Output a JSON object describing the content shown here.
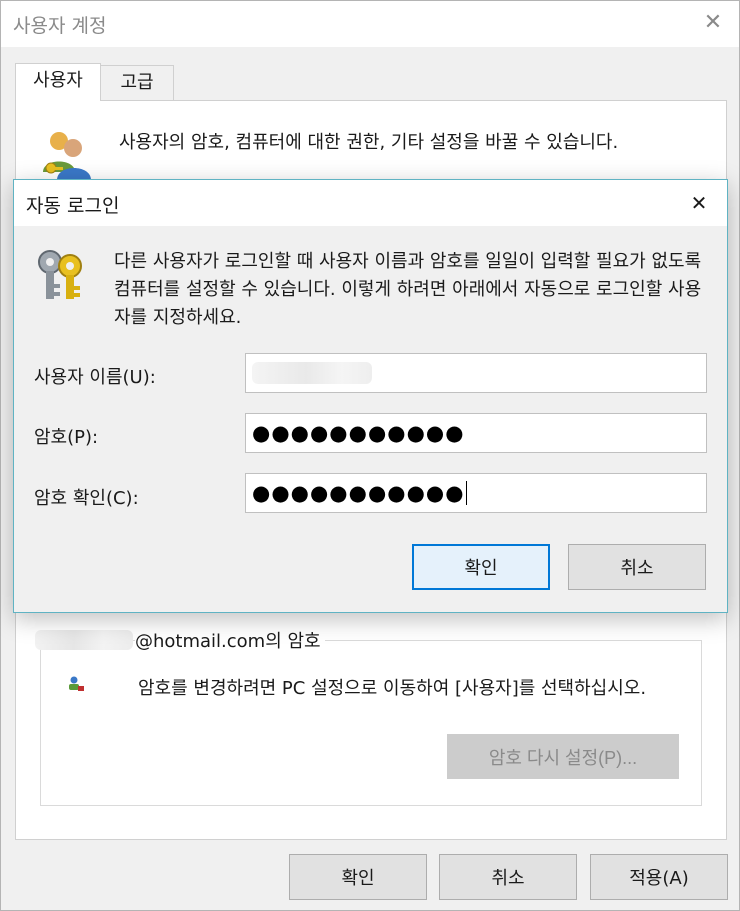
{
  "window": {
    "title": "사용자 계정",
    "close_glyph": "✕",
    "tabs": [
      {
        "label": "사용자",
        "active": true
      },
      {
        "label": "고급",
        "active": false
      }
    ],
    "description": "사용자의 암호, 컴퓨터에 대한 권한, 기타 설정을 바꿀 수 있습니다.",
    "password_group": {
      "label_suffix": "@hotmail.com의 암호",
      "text": "암호를 변경하려면 PC 설정으로 이동하여 [사용자]를 선택하십시오.",
      "reset_button": "암호 다시 설정(P)..."
    },
    "buttons": {
      "ok": "확인",
      "cancel": "취소",
      "apply": "적용(A)"
    }
  },
  "dialog": {
    "title": "자동 로그인",
    "close_glyph": "✕",
    "description": "다른 사용자가 로그인할 때 사용자 이름과 암호를 일일이 입력할 필요가 없도록 컴퓨터를 설정할 수 있습니다. 이렇게 하려면 아래에서 자동으로 로그인할 사용자를 지정하세요.",
    "fields": {
      "username_label": "사용자 이름(U):",
      "password_label": "암호(P):",
      "password_value": "●●●●●●●●●●●",
      "confirm_label": "암호 확인(C):",
      "confirm_value": "●●●●●●●●●●●"
    },
    "buttons": {
      "ok": "확인",
      "cancel": "취소"
    }
  },
  "icons": {
    "users": "users-icon",
    "keys": "keys-icon",
    "small": "user-account-small-icon"
  },
  "colors": {
    "accent": "#0078d7",
    "dialog_border": "#5fb3c3",
    "key_gold": "#e8c020"
  }
}
